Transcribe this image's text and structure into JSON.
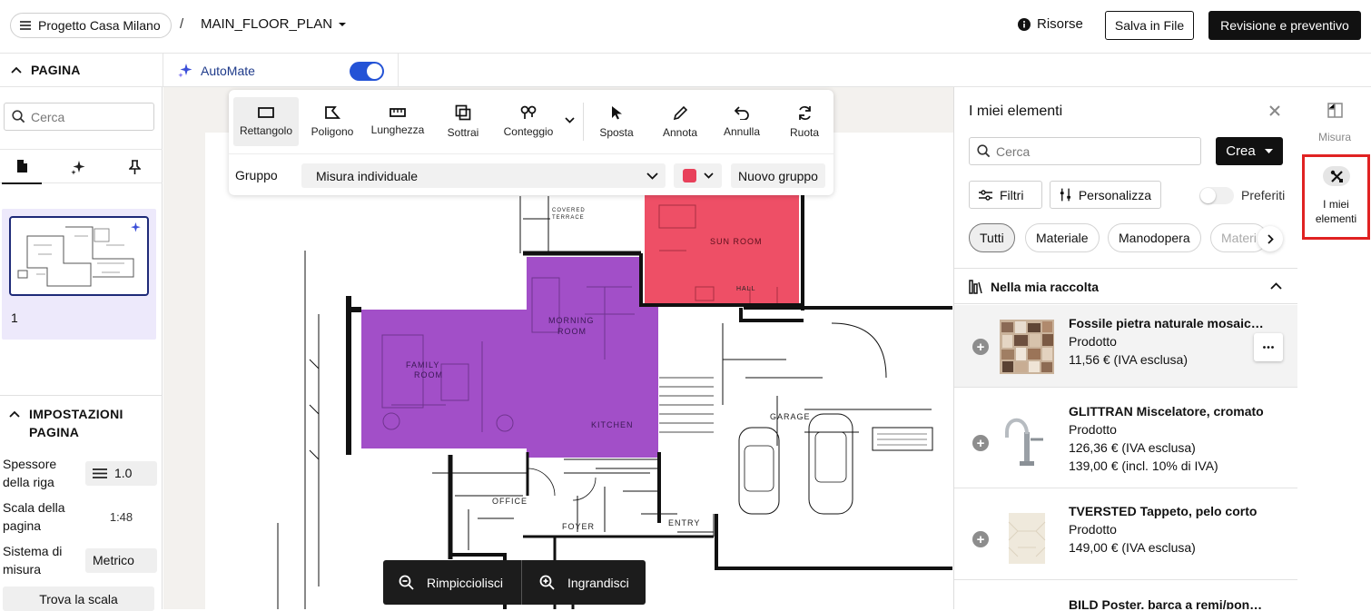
{
  "header": {
    "project": "Progetto Casa Milano",
    "separator": "/",
    "plan_name": "MAIN_FLOOR_PLAN",
    "resources": "Risorse",
    "save_file": "Salva in File",
    "review_quote": "Revisione e preventivo"
  },
  "subbar": {
    "page_label": "PAGINA",
    "automate": "AutoMate",
    "automate_on": true
  },
  "left_panel": {
    "search_placeholder": "Cerca",
    "page_number": "1",
    "settings_title_1": "IMPOSTAZIONI",
    "settings_title_2": "PAGINA",
    "settings": [
      {
        "label_1": "Spessore",
        "label_2": "della riga",
        "value": "1.0"
      },
      {
        "label_1": "Scala della",
        "label_2": "pagina",
        "value": "1:48"
      },
      {
        "label_1": "Sistema di",
        "label_2": "misura",
        "value": "Metrico"
      }
    ],
    "find_scale": "Trova la scala"
  },
  "toolbar": {
    "tools": [
      "Rettangolo",
      "Poligono",
      "Lunghezza",
      "Sottrai",
      "Conteggio",
      "Sposta",
      "Annota",
      "Annulla",
      "Ruota"
    ],
    "group_label": "Gruppo",
    "group_value": "Misura individuale",
    "group_color": "#e8405a",
    "new_group": "Nuovo gruppo"
  },
  "plan": {
    "colors": {
      "purple": "#a24fc8",
      "red": "#ee4f66"
    },
    "rooms": [
      "FAMILY ROOM",
      "MORNING ROOM",
      "KITCHEN",
      "SUN ROOM",
      "OFFICE",
      "FOYER",
      "ENTRY",
      "GARAGE",
      "HALL",
      "COVERED TERRACE"
    ]
  },
  "zoom": {
    "out": "Rimpicciolisci",
    "in": "Ingrandisci"
  },
  "right_panel": {
    "title": "I miei elementi",
    "search_placeholder": "Cerca",
    "create": "Crea",
    "filters": "Filtri",
    "customize": "Personalizza",
    "favorites": "Preferiti",
    "chips": [
      "Tutti",
      "Materiale",
      "Manodopera",
      "Materi"
    ],
    "collection": "Nella mia raccolta",
    "items": [
      {
        "name": "Fossile pietra naturale mosaico...",
        "type": "Prodotto",
        "price": "11,56 € (IVA esclusa)",
        "price2": ""
      },
      {
        "name": "GLITTRAN Miscelatore, cromato",
        "type": "Prodotto",
        "price": "126,36 € (IVA esclusa)",
        "price2": "139,00 € (incl. 10% di IVA)"
      },
      {
        "name": "TVERSTED Tappeto, pelo corto",
        "type": "Prodotto",
        "price": "149,00 € (IVA esclusa)",
        "price2": ""
      },
      {
        "name": "BILD Poster, barca a remi/pontili..."
      }
    ]
  },
  "rail": {
    "measure": "Misura",
    "my_items_1": "I miei",
    "my_items_2": "elementi"
  }
}
